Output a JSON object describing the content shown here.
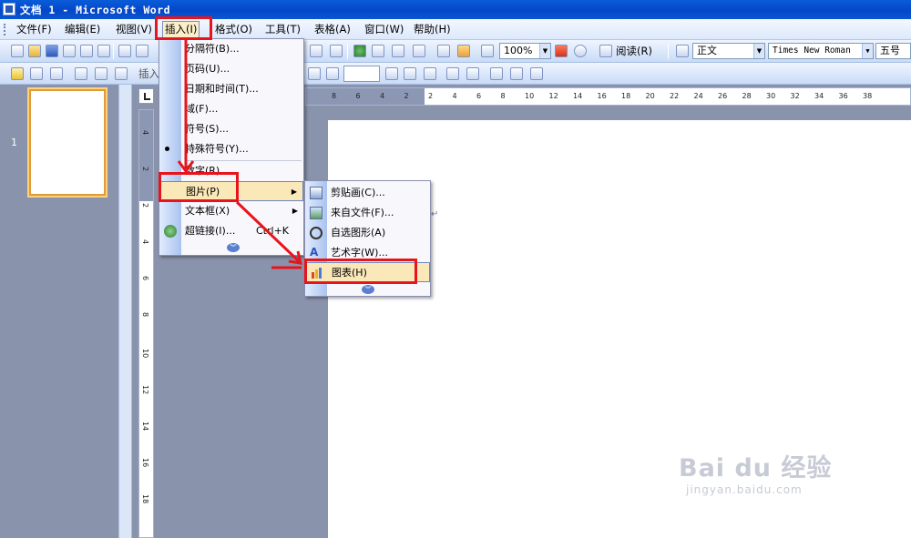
{
  "window": {
    "title": "文档 1 - Microsoft Word"
  },
  "menubar": {
    "items": [
      {
        "label": "文件(F)",
        "key": "file"
      },
      {
        "label": "编辑(E)",
        "key": "edit"
      },
      {
        "label": "视图(V)",
        "key": "view"
      },
      {
        "label": "插入(I)",
        "key": "insert",
        "active": true
      },
      {
        "label": "格式(O)",
        "key": "format"
      },
      {
        "label": "工具(T)",
        "key": "tools"
      },
      {
        "label": "表格(A)",
        "key": "table"
      },
      {
        "label": "窗口(W)",
        "key": "window"
      },
      {
        "label": "帮助(H)",
        "key": "help"
      }
    ]
  },
  "toolbar": {
    "zoom": "100%",
    "read_label": "阅读(R)",
    "style": "正文",
    "font": "Times New Roman",
    "size": "五号",
    "insert_label": "插入"
  },
  "insert_menu": {
    "items": [
      {
        "label": "分隔符(B)..."
      },
      {
        "label": "页码(U)..."
      },
      {
        "label": "日期和时间(T)..."
      },
      {
        "label": "域(F)..."
      },
      {
        "label": "符号(S)..."
      },
      {
        "label": "特殊符号(Y)..."
      },
      {
        "label": "数字(R)"
      },
      {
        "label": "图片(P)",
        "submenu": true,
        "highlighted": true
      },
      {
        "label": "文本框(X)",
        "submenu": true
      },
      {
        "label": "超链接(I)...",
        "shortcut": "Ctrl+K"
      }
    ]
  },
  "picture_submenu": {
    "items": [
      {
        "label": "剪贴画(C)...",
        "icon": "clipart-icon"
      },
      {
        "label": "来自文件(F)...",
        "icon": "picture-file-icon"
      },
      {
        "label": "自选图形(A)",
        "icon": "autoshape-icon"
      },
      {
        "label": "艺术字(W)...",
        "icon": "wordart-icon"
      },
      {
        "label": "图表(H)",
        "icon": "chart-icon",
        "highlighted": true
      }
    ]
  },
  "thumbnail": {
    "page_number": "1"
  },
  "ruler": {
    "horizontal": [
      "8",
      "6",
      "4",
      "2",
      "2",
      "4",
      "6",
      "8",
      "10",
      "12",
      "14",
      "16",
      "18",
      "20",
      "22",
      "24",
      "26",
      "28",
      "30",
      "32",
      "34",
      "36",
      "38"
    ],
    "vertical": [
      "4",
      "2",
      "2",
      "4",
      "6",
      "8",
      "10",
      "12",
      "14",
      "16",
      "18"
    ]
  },
  "watermark": {
    "brand": "Bai du 经验",
    "url": "jingyan.baidu.com"
  },
  "colors": {
    "annotation_red": "#e8141c",
    "titlebar_blue": "#0a56d0",
    "menu_highlight": "#fbe8b8"
  }
}
